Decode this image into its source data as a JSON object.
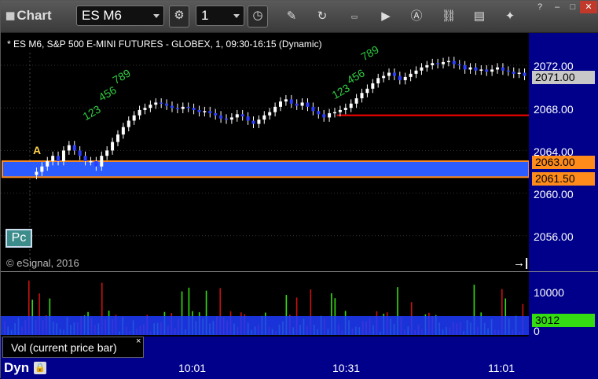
{
  "app": {
    "title": "Chart"
  },
  "toolbar": {
    "symbol": "ES M6",
    "interval": "1"
  },
  "chart": {
    "title": "* ES M6, S&P 500 E-MINI FUTURES - GLOBEX, 1, 09:30-16:15 (Dynamic)",
    "copyright": "© eSignal, 2016",
    "price_ticks": [
      "2072.00",
      "2068.00",
      "2064.00",
      "2060.00",
      "2056.00"
    ],
    "price_tags": [
      {
        "label": "2071.00",
        "bg": "#c8c8c8",
        "fg": "#000000"
      },
      {
        "label": "2063.00",
        "bg": "#ff8c1a",
        "fg": "#000000"
      },
      {
        "label": "2061.50",
        "bg": "#ff8c1a",
        "fg": "#000000"
      }
    ],
    "marker_a": "A",
    "marker_pc": "Pc",
    "annotations": [
      "123",
      "456",
      "789",
      "123",
      "456",
      "789"
    ]
  },
  "volume": {
    "label": "Vol (current price bar)",
    "ticks": [
      "10000",
      "0"
    ],
    "current": "3012",
    "current_color": "#33dd11"
  },
  "time_axis": {
    "mode": "Dyn",
    "labels": [
      "10:01",
      "10:31",
      "11:01"
    ]
  },
  "colors": {
    "band": "#2a5cff",
    "band_border": "#ff8c1a",
    "line_red": "#ff0000",
    "bar_up": "#ffffff",
    "bar_down": "#2a3cff",
    "vol_up": "#33dd11",
    "vol_down": "#cc1111",
    "annotation": "#2ecc40"
  }
}
